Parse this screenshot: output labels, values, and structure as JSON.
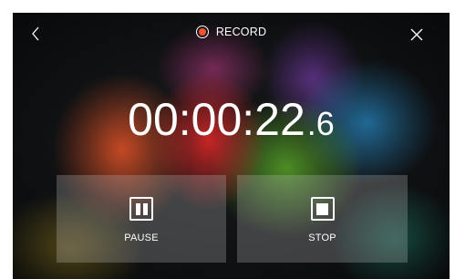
{
  "header": {
    "title": "RECORD",
    "back_icon": "chevron-left-icon",
    "close_icon": "close-icon",
    "record_icon": "record-icon",
    "record_color": "#f0542c"
  },
  "timer": {
    "main": "00:00:22",
    "fraction": ".6"
  },
  "controls": {
    "pause_label": "PAUSE",
    "pause_icon": "pause-icon",
    "stop_label": "STOP",
    "stop_icon": "stop-icon"
  }
}
